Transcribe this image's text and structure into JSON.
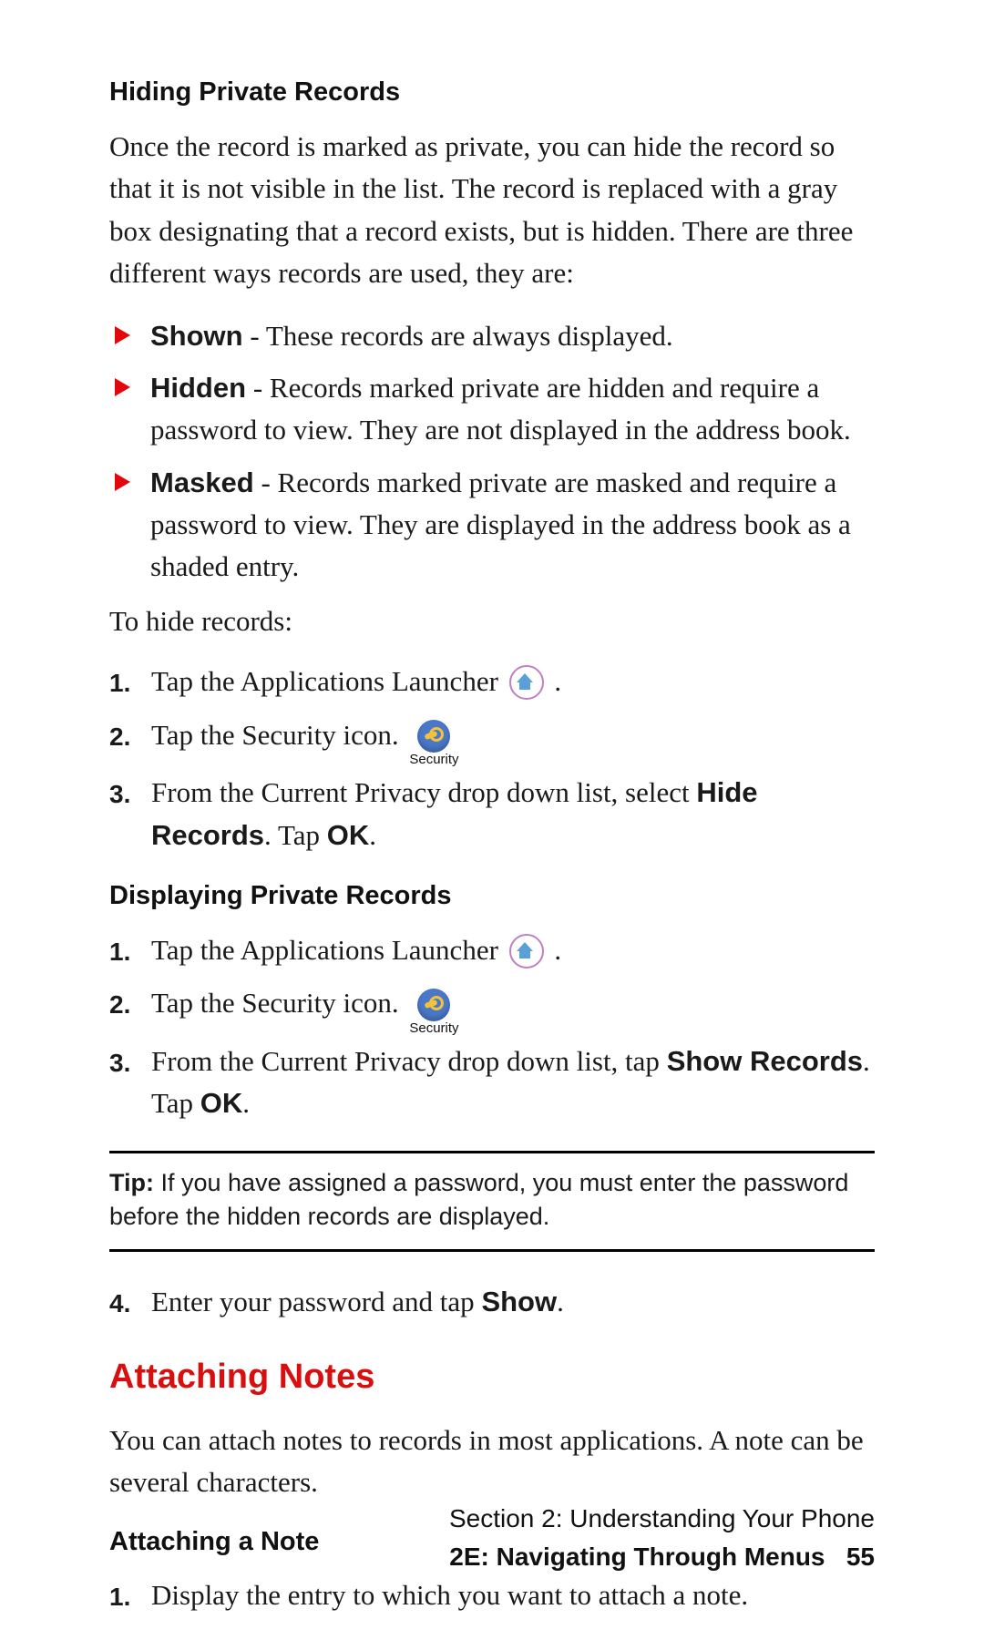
{
  "section1": {
    "heading": "Hiding Private Records",
    "intro": "Once the record is marked as private, you can hide the record so that it is not visible in the list. The record is replaced with a gray box designating that a record exists, but is hidden. There are three different ways records are used, they are:",
    "bullets": [
      {
        "label": "Shown",
        "text": " - These records are always displayed."
      },
      {
        "label": "Hidden",
        "text": " - Records marked private are hidden and require a password to view. They are not displayed in the address book."
      },
      {
        "label": "Masked",
        "text": " - Records marked private are masked and require a password to view. They are displayed in the address book as a shaded entry."
      }
    ],
    "lead": "To hide records:",
    "steps": [
      {
        "n": "1.",
        "pre": "Tap the Applications Launcher ",
        "icon": "home",
        "post": " ."
      },
      {
        "n": "2.",
        "pre": "Tap the Security icon. ",
        "icon": "security",
        "post": ""
      },
      {
        "n": "3.",
        "pre": "From the Current Privacy drop down list, select ",
        "bold1": "Hide Records",
        "mid": ". Tap ",
        "bold2": "OK",
        "post": "."
      }
    ]
  },
  "section2": {
    "heading": "Displaying Private Records",
    "steps": [
      {
        "n": "1.",
        "pre": "Tap the Applications Launcher ",
        "icon": "home",
        "post": " ."
      },
      {
        "n": "2.",
        "pre": "Tap the Security icon. ",
        "icon": "security",
        "post": ""
      },
      {
        "n": "3.",
        "pre": "From the Current Privacy drop down list, tap ",
        "bold1": "Show Records",
        "mid": ". Tap ",
        "bold2": "OK",
        "post": "."
      }
    ]
  },
  "tip": {
    "label": "Tip:",
    "text": " If you have assigned a password, you must enter the password before the hidden records are displayed."
  },
  "step4": {
    "n": "4.",
    "pre": "Enter your password and tap ",
    "bold1": "Show",
    "post": "."
  },
  "section3": {
    "title": "Attaching Notes",
    "intro": "You can attach notes to records in most applications. A note can be several characters.",
    "subheading": "Attaching a Note",
    "steps": [
      {
        "n": "1.",
        "text": "Display the entry to which you want to attach a note."
      }
    ]
  },
  "icons": {
    "security_label": "Security"
  },
  "footer": {
    "line1": "Section 2: Understanding Your Phone",
    "line2_label": "2E: Navigating Through Menus",
    "page": "55"
  }
}
